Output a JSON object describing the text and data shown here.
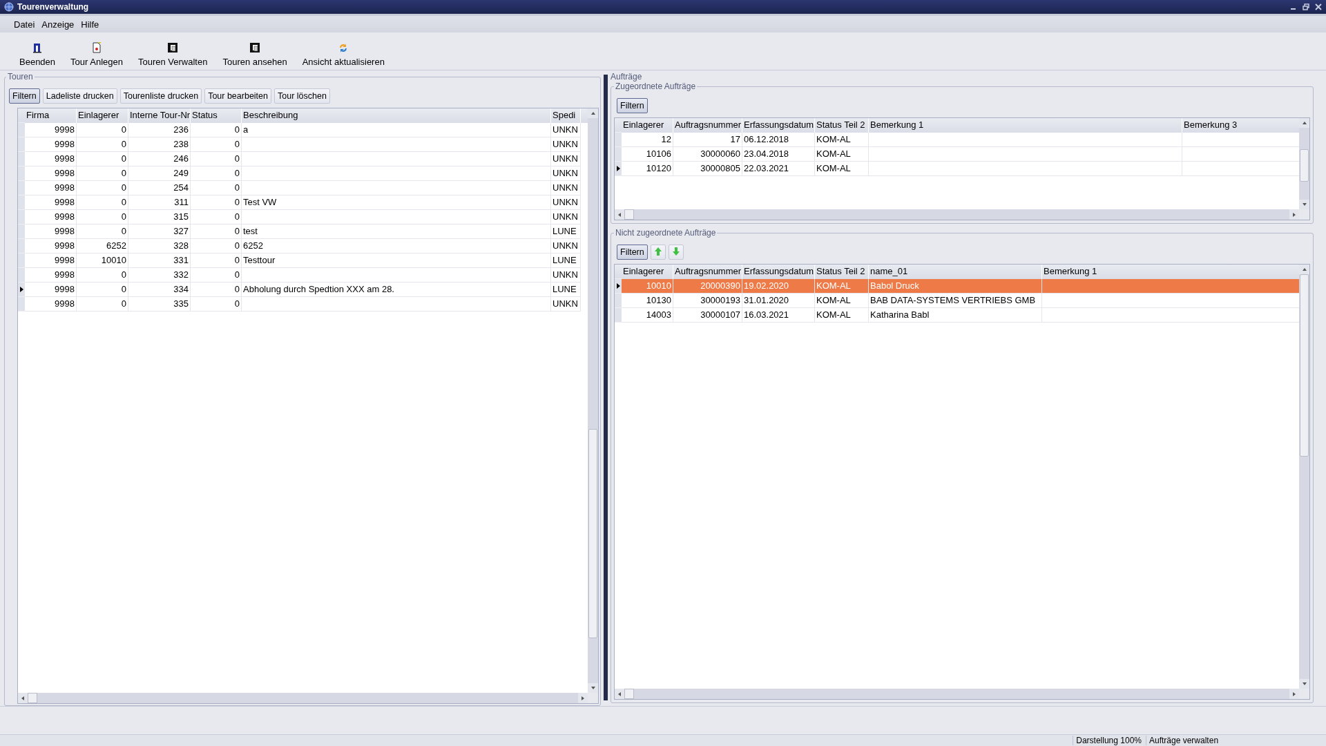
{
  "window": {
    "title": "Tourenverwaltung"
  },
  "menu": [
    "Datei",
    "Anzeige",
    "Hilfe"
  ],
  "toolbar": [
    {
      "label": "Beenden",
      "kind": "exit"
    },
    {
      "label": "Tour Anlegen",
      "kind": "new"
    },
    {
      "label": "Touren Verwalten",
      "kind": "manage"
    },
    {
      "label": "Touren ansehen",
      "kind": "view"
    },
    {
      "label": "Ansicht aktualisieren",
      "kind": "refresh"
    }
  ],
  "touren": {
    "title": "Touren",
    "buttons": [
      {
        "label": "Filtern",
        "focused": true
      },
      {
        "label": "Ladeliste drucken",
        "focused": false
      },
      {
        "label": "Tourenliste drucken",
        "focused": false
      },
      {
        "label": "Tour bearbeiten",
        "focused": false
      },
      {
        "label": "Tour löschen",
        "focused": false
      }
    ],
    "table": {
      "columns": [
        "Firma",
        "Einlagerer",
        "Interne Tour-Nr",
        "Status",
        "Beschreibung",
        "Spedi"
      ],
      "rows": [
        {
          "current": false,
          "cells": [
            "9998",
            "0",
            "236",
            "0",
            "a",
            "UNKN"
          ]
        },
        {
          "current": false,
          "cells": [
            "9998",
            "0",
            "238",
            "0",
            null,
            "UNKN"
          ]
        },
        {
          "current": false,
          "cells": [
            "9998",
            "0",
            "246",
            "0",
            null,
            "UNKN"
          ]
        },
        {
          "current": false,
          "cells": [
            "9998",
            "0",
            "249",
            "0",
            null,
            "UNKN"
          ]
        },
        {
          "current": false,
          "cells": [
            "9998",
            "0",
            "254",
            "0",
            null,
            "UNKN"
          ]
        },
        {
          "current": false,
          "cells": [
            "9998",
            "0",
            "311",
            "0",
            "Test VW",
            "UNKN"
          ]
        },
        {
          "current": false,
          "cells": [
            "9998",
            "0",
            "315",
            "0",
            null,
            "UNKN"
          ]
        },
        {
          "current": false,
          "cells": [
            "9998",
            "0",
            "327",
            "0",
            "test",
            "LUNE"
          ]
        },
        {
          "current": false,
          "cells": [
            "9998",
            "6252",
            "328",
            "0",
            "6252",
            "UNKN"
          ]
        },
        {
          "current": false,
          "cells": [
            "9998",
            "10010",
            "331",
            "0",
            "Testtour",
            "LUNE"
          ]
        },
        {
          "current": false,
          "cells": [
            "9998",
            "0",
            "332",
            "0",
            null,
            "UNKN"
          ]
        },
        {
          "current": true,
          "cells": [
            "9998",
            "0",
            "334",
            "0",
            "Abholung durch Spedtion XXX am 28.",
            "LUNE"
          ]
        },
        {
          "current": false,
          "cells": [
            "9998",
            "0",
            "335",
            "0",
            null,
            "UNKN"
          ]
        }
      ]
    }
  },
  "auftraege": {
    "title": "Aufträge",
    "assigned": {
      "title": "Zugeordnete Aufträge",
      "filter_button": {
        "label": "Filtern",
        "focused": true
      },
      "table": {
        "columns": [
          "Einlagerer",
          "Auftragsnummer",
          "Erfassungsdatum",
          "Status Teil 2",
          "Bemerkung 1",
          "Bemerkung 3"
        ],
        "rows": [
          {
            "current": false,
            "cells": [
              "12",
              "17",
              "06.12.2018",
              "KOM-AL",
              null,
              null
            ]
          },
          {
            "current": false,
            "cells": [
              "10106",
              "30000060",
              "23.04.2018",
              "KOM-AL",
              null,
              null
            ]
          },
          {
            "current": true,
            "cells": [
              "10120",
              "30000805",
              "22.03.2021",
              "KOM-AL",
              null,
              null
            ]
          }
        ]
      }
    },
    "unassigned": {
      "title": "Nicht zugeordnete Aufträge",
      "filter_button": {
        "label": "Filtern",
        "focused": true
      },
      "table": {
        "columns": [
          "Einlagerer",
          "Auftragsnummer",
          "Erfassungsdatum",
          "Status Teil 2",
          "name_01",
          "Bemerkung 1"
        ],
        "rows": [
          {
            "current": true,
            "selected": true,
            "cells": [
              "10010",
              "20000390",
              "19.02.2020",
              "KOM-AL",
              "Babol Druck",
              null
            ]
          },
          {
            "current": false,
            "selected": false,
            "cells": [
              "10130",
              "30000193",
              "31.01.2020",
              "KOM-AL",
              "BAB DATA-SYSTEMS VERTRIEBS GMB",
              null
            ]
          },
          {
            "current": false,
            "selected": false,
            "cells": [
              "14003",
              "30000107",
              "16.03.2021",
              "KOM-AL",
              " Katharina Babl",
              null
            ]
          }
        ]
      }
    }
  },
  "status_bar": [
    "Darstellung 100%",
    "Aufträge verwalten"
  ]
}
